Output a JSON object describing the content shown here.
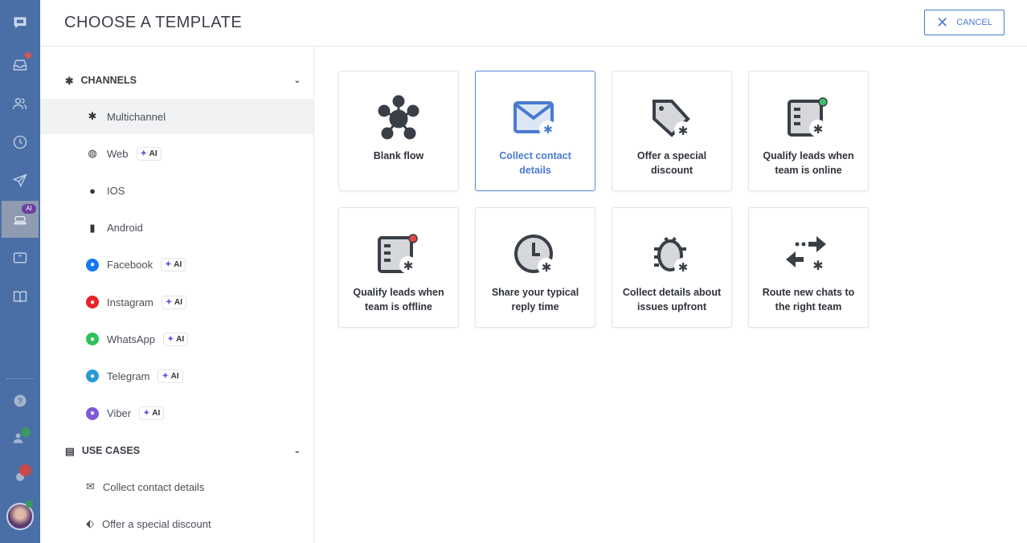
{
  "header": {
    "title": "CHOOSE A TEMPLATE",
    "cancel_label": "CANCEL"
  },
  "rail": {
    "ai_badge": "AI"
  },
  "sidebar": {
    "channels_label": "CHANNELS",
    "channels": [
      {
        "label": "Multichannel",
        "icon": "multichannel-icon",
        "ai": false
      },
      {
        "label": "Web",
        "icon": "globe-icon",
        "ai": true
      },
      {
        "label": "IOS",
        "icon": "apple-icon",
        "ai": false
      },
      {
        "label": "Android",
        "icon": "android-icon",
        "ai": false
      },
      {
        "label": "Facebook",
        "icon": "messenger-icon",
        "ai": true,
        "color": "#1877f2"
      },
      {
        "label": "Instagram",
        "icon": "instagram-icon",
        "ai": true,
        "color": "#e8242b"
      },
      {
        "label": "WhatsApp",
        "icon": "whatsapp-icon",
        "ai": true,
        "color": "#2cc35a"
      },
      {
        "label": "Telegram",
        "icon": "telegram-icon",
        "ai": true,
        "color": "#2a9ad6"
      },
      {
        "label": "Viber",
        "icon": "viber-icon",
        "ai": true,
        "color": "#7d5ad8"
      }
    ],
    "ai_label": "AI",
    "use_cases_label": "USE CASES",
    "use_cases": [
      {
        "label": "Collect contact details"
      },
      {
        "label": "Offer a special discount"
      }
    ]
  },
  "templates": [
    {
      "label": "Blank flow"
    },
    {
      "label": "Collect contact details"
    },
    {
      "label": "Offer a special discount"
    },
    {
      "label": "Qualify leads when team is online"
    },
    {
      "label": "Qualify leads when team is offline"
    },
    {
      "label": "Share your typical reply time"
    },
    {
      "label": "Collect details about issues upfront"
    },
    {
      "label": "Route new chats to the right team"
    }
  ]
}
